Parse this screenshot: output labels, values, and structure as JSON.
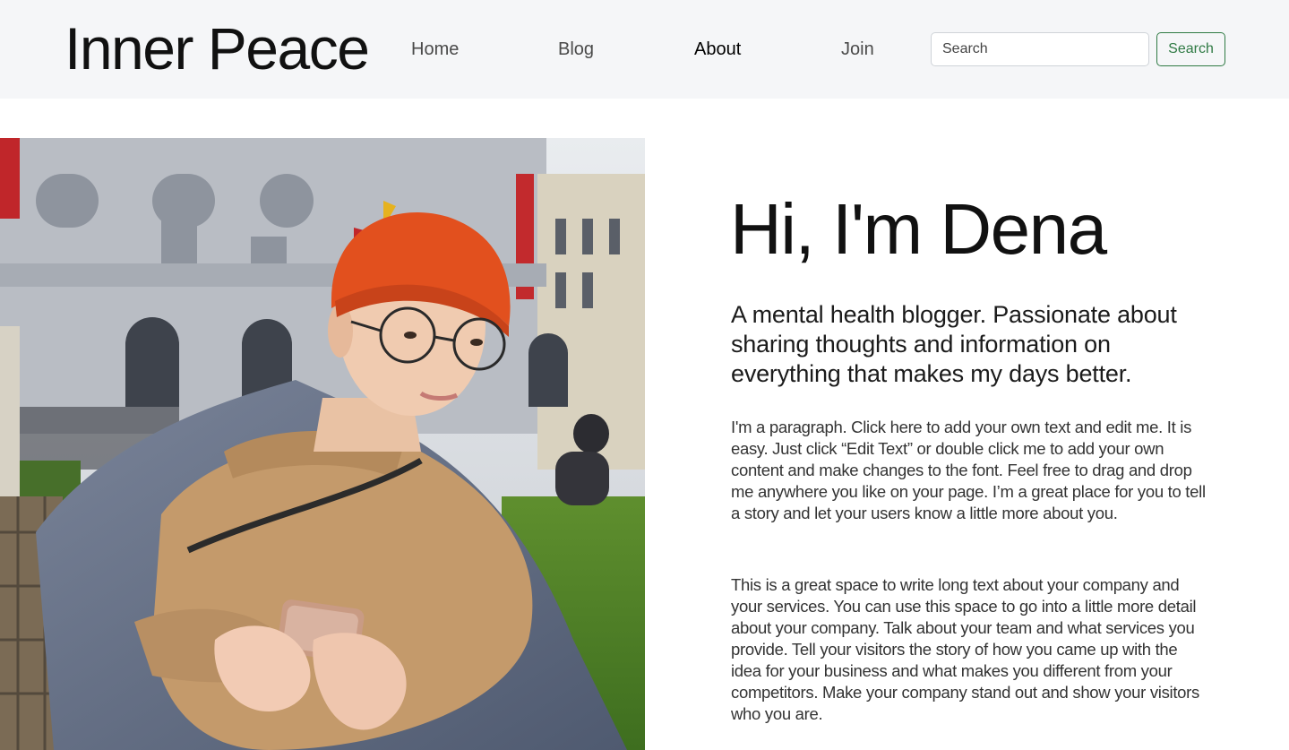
{
  "nav": {
    "brand": "Inner Peace",
    "links": [
      {
        "label": "Home"
      },
      {
        "label": "Blog"
      },
      {
        "label": "About"
      },
      {
        "label": "Join"
      }
    ],
    "search": {
      "placeholder": "Search",
      "button_label": "Search"
    },
    "colors": {
      "background": "#f5f6f8",
      "search_button": "#2f7a44"
    }
  },
  "about": {
    "title": "Hi, I'm Dena",
    "subtitle": "A mental health blogger. Passionate about sharing thoughts and information on everything that makes my days better.",
    "paragraph_1": "I'm a paragraph. Click here to add your own text and edit me. It is easy. Just click “Edit Text” or double click me to add your own content and make changes to the font. Feel free to drag and drop me anywhere you like on your page. I’m a great place for you to tell a story and let your users know a little more about you.",
    "paragraph_2": "This is a great space to write long text about your company and your services. You can use this space to go into a little more detail about your company. Talk about your team and what services you provide. Tell your visitors the story of how you came up with the idea for your business and what makes you different from your competitors. Make your company stand out and show your visitors who you are."
  }
}
